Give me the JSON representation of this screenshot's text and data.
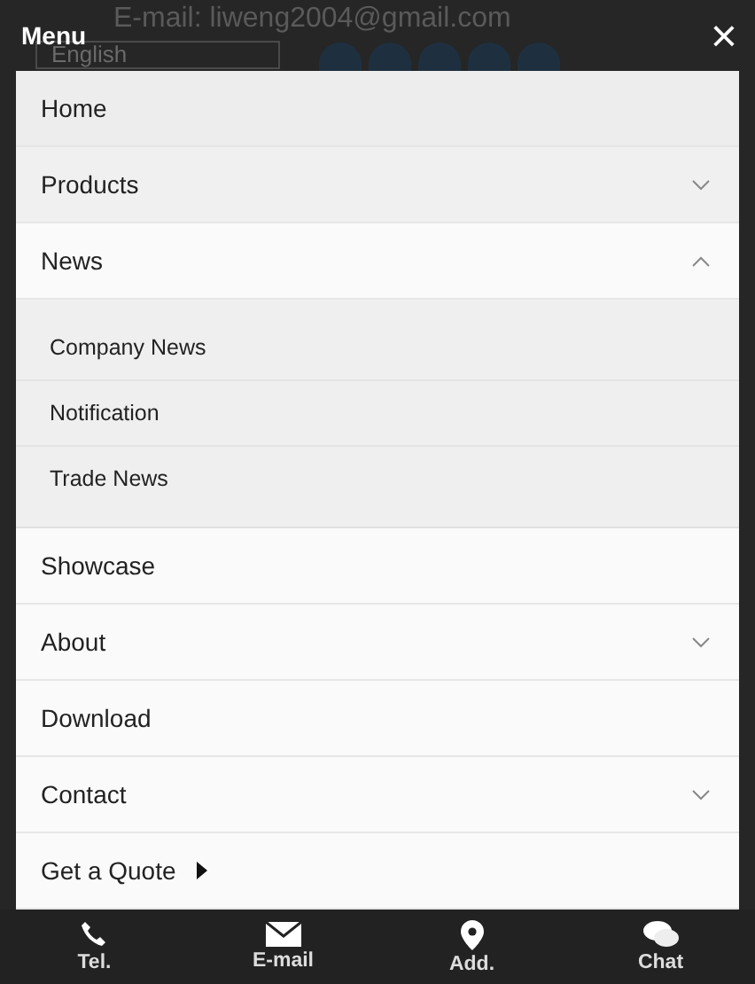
{
  "background": {
    "email": "E-mail: liweng2004@gmail.com",
    "language": "English"
  },
  "menu": {
    "title": "Menu",
    "close": "×",
    "items": [
      {
        "label": "Home",
        "kind": "plain"
      },
      {
        "label": "Products",
        "kind": "dropdown",
        "expanded": false
      },
      {
        "label": "News",
        "kind": "dropdown",
        "expanded": true,
        "children": [
          {
            "label": "Company News"
          },
          {
            "label": "Notification"
          },
          {
            "label": "Trade News"
          }
        ]
      },
      {
        "label": "Showcase",
        "kind": "plain"
      },
      {
        "label": "About",
        "kind": "dropdown",
        "expanded": false
      },
      {
        "label": "Download",
        "kind": "plain"
      },
      {
        "label": "Contact",
        "kind": "dropdown",
        "expanded": false
      },
      {
        "label": "Get a Quote",
        "kind": "arrow-link"
      }
    ]
  },
  "bottom_bar": [
    {
      "label": "Tel.",
      "kind": "phone"
    },
    {
      "label": "E-mail",
      "kind": "mail"
    },
    {
      "label": "Add.",
      "kind": "pin"
    },
    {
      "label": "Chat",
      "kind": "chat"
    }
  ]
}
